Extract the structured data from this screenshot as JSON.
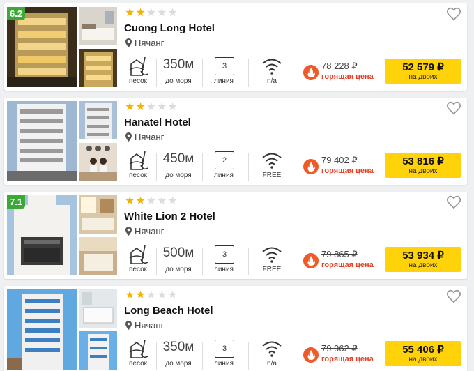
{
  "hotels": [
    {
      "score": "6.2",
      "stars": 2,
      "name": "Cuong Long Hotel",
      "city": "Нячанг",
      "beach": "песок",
      "distance": "350м",
      "distance_caption": "до моря",
      "line": "3",
      "line_caption": "линия",
      "wifi": "n/a",
      "old_price": "78 228 ₽",
      "hot_label": "горящая цена",
      "price": "52 579 ₽",
      "price_caption": "на двоих"
    },
    {
      "score": "",
      "stars": 2,
      "name": "Hanatel Hotel",
      "city": "Нячанг",
      "beach": "песок",
      "distance": "450м",
      "distance_caption": "до моря",
      "line": "2",
      "line_caption": "линия",
      "wifi": "FREE",
      "old_price": "79 402 ₽",
      "hot_label": "горящая цена",
      "price": "53 816 ₽",
      "price_caption": "на двоих"
    },
    {
      "score": "7.1",
      "stars": 2,
      "name": "White Lion 2 Hotel",
      "city": "Нячанг",
      "beach": "песок",
      "distance": "500м",
      "distance_caption": "до моря",
      "line": "3",
      "line_caption": "линия",
      "wifi": "FREE",
      "old_price": "79 865 ₽",
      "hot_label": "горящая цена",
      "price": "53 934 ₽",
      "price_caption": "на двоих"
    },
    {
      "score": "",
      "stars": 2,
      "name": "Long Beach Hotel",
      "city": "Нячанг",
      "beach": "песок",
      "distance": "350м",
      "distance_caption": "до моря",
      "line": "3",
      "line_caption": "линия",
      "wifi": "n/a",
      "old_price": "79 962 ₽",
      "hot_label": "горящая цена",
      "price": "55 406 ₽",
      "price_caption": "на двоих"
    }
  ],
  "icons": {
    "location": "map-pin-icon",
    "beach": "sand-bucket-icon",
    "wifi": "wifi-icon",
    "hot": "fire-icon",
    "favorite": "heart-icon"
  },
  "colors": {
    "accent_yellow": "#ffd20a",
    "hot_red": "#e3432b",
    "star": "#f5b301",
    "score_green": "#3ca937"
  }
}
